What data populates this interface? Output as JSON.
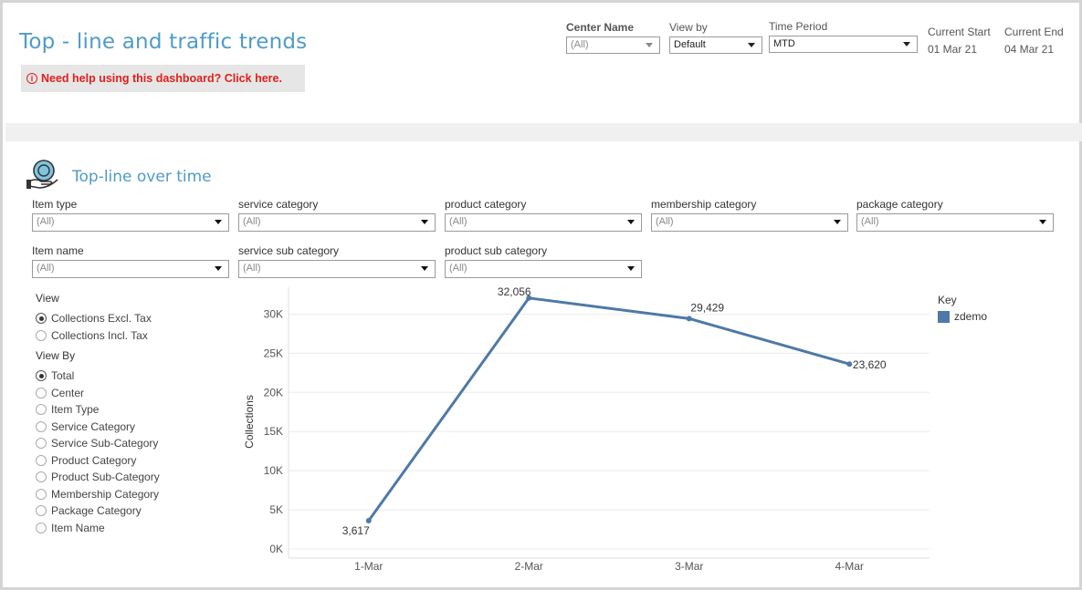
{
  "header": {
    "title": "Top - line and traffic trends",
    "help_text": "Need help using this dashboard? Click here."
  },
  "top_filters": {
    "center_name": {
      "label": "Center Name",
      "value": "(All)"
    },
    "view_by": {
      "label": "View by",
      "value": "Default"
    },
    "time_period": {
      "label": "Time Period",
      "value": "MTD"
    },
    "current_start": {
      "label": "Current Start",
      "value": "01 Mar 21"
    },
    "current_end": {
      "label": "Current End",
      "value": "04 Mar 21"
    }
  },
  "section": {
    "title": "Top-line over time"
  },
  "filters": {
    "item_type": {
      "label": "Item type",
      "value": "(All)"
    },
    "service_category": {
      "label": "service category",
      "value": "(All)"
    },
    "product_category": {
      "label": "product category",
      "value": "(All)"
    },
    "membership_category": {
      "label": "membership category",
      "value": "(All)"
    },
    "package_category": {
      "label": "package category",
      "value": "(All)"
    },
    "item_name": {
      "label": "Item name",
      "value": "(All)"
    },
    "service_sub_category": {
      "label": "service sub category",
      "value": "(All)"
    },
    "product_sub_category": {
      "label": "product sub category",
      "value": "(All)"
    }
  },
  "view": {
    "label": "View",
    "options": [
      "Collections Excl. Tax",
      "Collections Incl. Tax"
    ],
    "selected": "Collections Excl. Tax"
  },
  "view_by": {
    "label": "View By",
    "options": [
      "Total",
      "Center",
      "Item Type",
      "Service Category",
      "Service Sub-Category",
      "Product Category",
      "Product Sub-Category",
      "Membership Category",
      "Package Category",
      "Item Name"
    ],
    "selected": "Total"
  },
  "legend": {
    "title": "Key",
    "items": [
      {
        "name": "zdemo",
        "color": "#4e79a7"
      }
    ]
  },
  "chart_data": {
    "type": "line",
    "categories": [
      "1-Mar",
      "2-Mar",
      "3-Mar",
      "4-Mar"
    ],
    "series": [
      {
        "name": "zdemo",
        "values": [
          3617,
          32056,
          29429,
          23620
        ],
        "color": "#4e79a7"
      }
    ],
    "data_labels": [
      "3,617",
      "32,056",
      "29,429",
      "23,620"
    ],
    "ylabel": "Collections",
    "xlabel": "",
    "yticks": [
      0,
      5000,
      10000,
      15000,
      20000,
      25000,
      30000
    ],
    "ytick_labels": [
      "0K",
      "5K",
      "10K",
      "15K",
      "20K",
      "25K",
      "30K"
    ],
    "ylim": [
      0,
      32500
    ],
    "grid": true
  }
}
